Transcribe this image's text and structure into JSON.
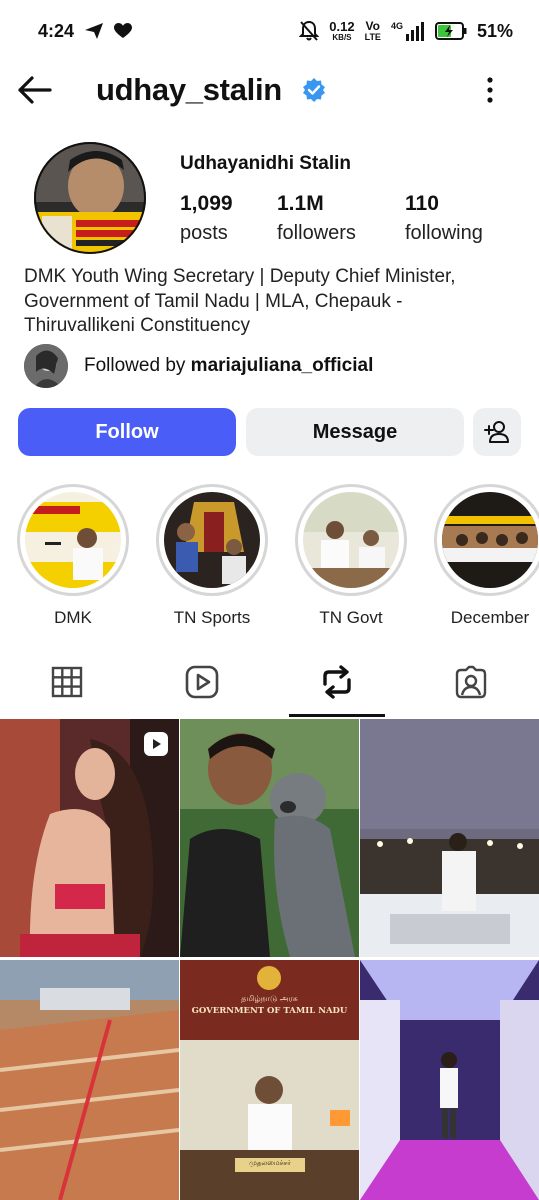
{
  "status_bar": {
    "time": "4:24",
    "net_speed_value": "0.12",
    "net_speed_unit": "KB/S",
    "volte_top": "Vo",
    "volte_bottom": "LTE",
    "network": "4G",
    "battery_percent": "51%",
    "icons": [
      "send-icon",
      "heart-icon",
      "mute-bell-icon",
      "signal-icon",
      "battery-charging-icon"
    ]
  },
  "header": {
    "username": "udhay_stalin",
    "icons": [
      "back-arrow-icon",
      "verified-badge-icon",
      "more-options-icon"
    ]
  },
  "profile": {
    "display_name": "Udhayanidhi Stalin",
    "stats": [
      {
        "value": "1,099",
        "label": "posts"
      },
      {
        "value": "1.1M",
        "label": "followers"
      },
      {
        "value": "110",
        "label": "following"
      }
    ],
    "bio": "DMK Youth Wing Secretary | Deputy Chief Minister, Government of Tamil Nadu | MLA, Chepauk - Thiruvallikeni Constituency",
    "followed_by_prefix": "Followed by ",
    "followed_by_user": "mariajuliana_official"
  },
  "actions": {
    "follow_label": "Follow",
    "message_label": "Message"
  },
  "highlights": [
    {
      "label": "DMK"
    },
    {
      "label": "TN Sports"
    },
    {
      "label": "TN Govt"
    },
    {
      "label": "December"
    }
  ],
  "tabs": [
    "grid-icon",
    "reels-icon",
    "reposts-icon",
    "tagged-icon"
  ],
  "grid_overlays": {
    "gov_text_tamil": "தமிழ்நாடு அரசு",
    "gov_text_english": "GOVERNMENT OF TAMIL NADU",
    "nameplate": "முதலமைச்சர்"
  },
  "colors": {
    "follow_button": "#4a5ef7",
    "secondary_button": "#eeeff1",
    "verified": "#3897f0",
    "battery": "#3cc43c"
  }
}
